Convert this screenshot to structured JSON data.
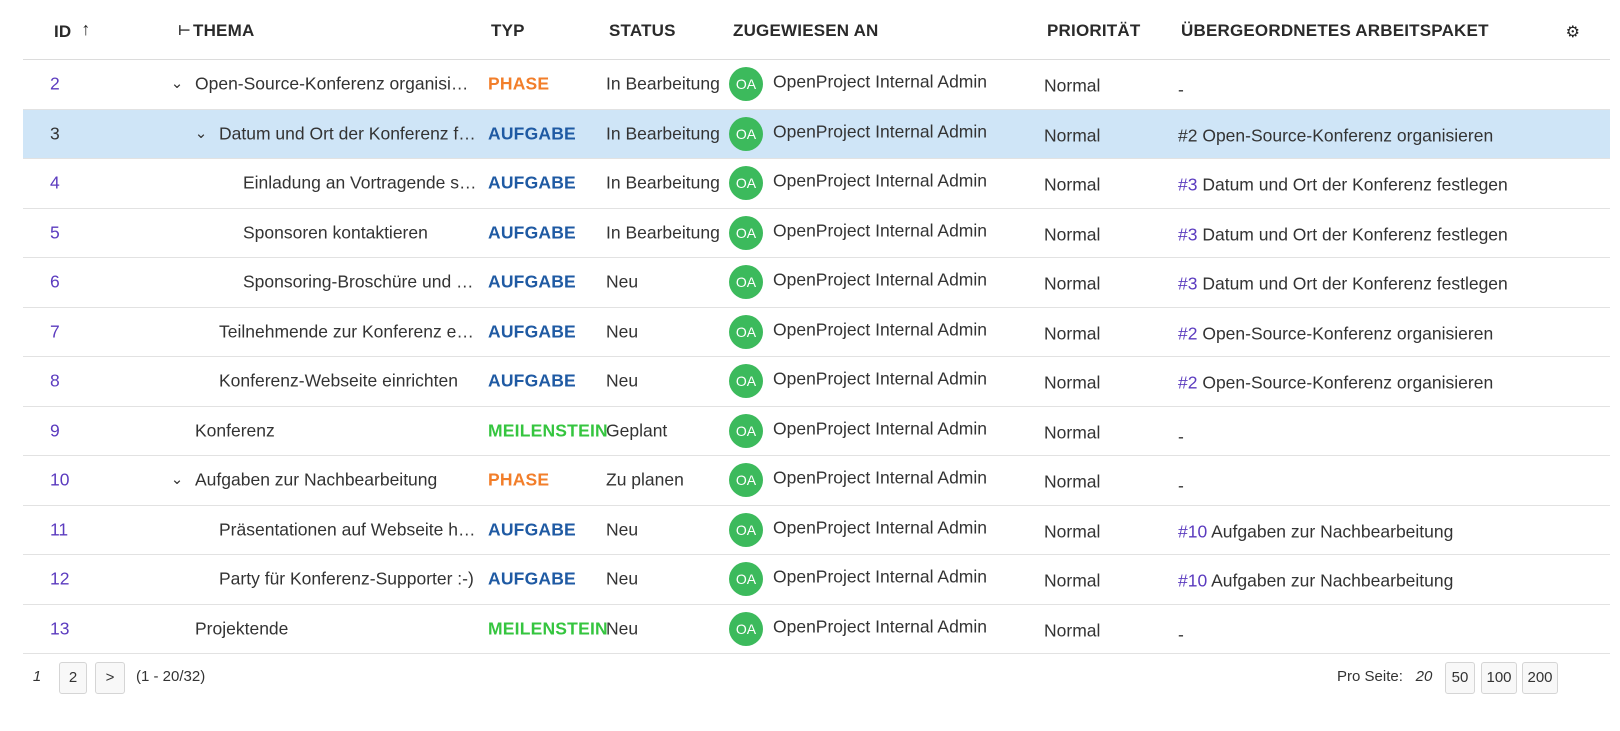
{
  "header": {
    "id": "ID",
    "sort_icon": "↑",
    "hierarchy_icon": "⊢",
    "subject": "THEMA",
    "type": "TYP",
    "status": "STATUS",
    "assignee": "ZUGEWIESEN AN",
    "priority": "PRIORITÄT",
    "parent": "ÜBERGEORDNETES ARBEITSPAKET",
    "settings_icon": "⚙"
  },
  "colors": {
    "phase": "#f27e2a",
    "task": "#1f5aa3",
    "milestone": "#35c53f",
    "link": "#5b3bbf",
    "selected_row": "#cfe5f7",
    "avatar": "#3cba5c"
  },
  "rows": [
    {
      "id": "2",
      "subject": "Open-Source-Konferenz organisiere...",
      "type": "PHASE",
      "type_color": "#f27e2a",
      "status": "In Bearbeitung",
      "avatar": "OA",
      "assignee": "OpenProject Internal Admin",
      "priority": "Normal",
      "parent_id": "",
      "parent_title": "-",
      "level": 0,
      "expandable": true,
      "selected": false
    },
    {
      "id": "3",
      "subject": "Datum und Ort der Konferenz fe...",
      "type": "AUFGABE",
      "type_color": "#1f5aa3",
      "status": "In Bearbeitung",
      "avatar": "OA",
      "assignee": "OpenProject Internal Admin",
      "priority": "Normal",
      "parent_id": "#2",
      "parent_title": " Open-Source-Konferenz organisieren",
      "level": 1,
      "expandable": true,
      "selected": true
    },
    {
      "id": "4",
      "subject": "Einladung an Vortragende se...",
      "type": "AUFGABE",
      "type_color": "#1f5aa3",
      "status": "In Bearbeitung",
      "avatar": "OA",
      "assignee": "OpenProject Internal Admin",
      "priority": "Normal",
      "parent_id": "#3",
      "parent_title": " Datum und Ort der Konferenz festlegen",
      "level": 2,
      "expandable": false,
      "selected": false
    },
    {
      "id": "5",
      "subject": "Sponsoren kontaktieren",
      "type": "AUFGABE",
      "type_color": "#1f5aa3",
      "status": "In Bearbeitung",
      "avatar": "OA",
      "assignee": "OpenProject Internal Admin",
      "priority": "Normal",
      "parent_id": "#3",
      "parent_title": " Datum und Ort der Konferenz festlegen",
      "level": 2,
      "expandable": false,
      "selected": false
    },
    {
      "id": "6",
      "subject": "Sponsoring-Broschüre und Fl...",
      "type": "AUFGABE",
      "type_color": "#1f5aa3",
      "status": "Neu",
      "avatar": "OA",
      "assignee": "OpenProject Internal Admin",
      "priority": "Normal",
      "parent_id": "#3",
      "parent_title": " Datum und Ort der Konferenz festlegen",
      "level": 2,
      "expandable": false,
      "selected": false
    },
    {
      "id": "7",
      "subject": "Teilnehmende zur Konferenz einl...",
      "type": "AUFGABE",
      "type_color": "#1f5aa3",
      "status": "Neu",
      "avatar": "OA",
      "assignee": "OpenProject Internal Admin",
      "priority": "Normal",
      "parent_id": "#2",
      "parent_title": " Open-Source-Konferenz organisieren",
      "level": 1,
      "expandable": false,
      "selected": false
    },
    {
      "id": "8",
      "subject": "Konferenz-Webseite einrichten",
      "type": "AUFGABE",
      "type_color": "#1f5aa3",
      "status": "Neu",
      "avatar": "OA",
      "assignee": "OpenProject Internal Admin",
      "priority": "Normal",
      "parent_id": "#2",
      "parent_title": " Open-Source-Konferenz organisieren",
      "level": 1,
      "expandable": false,
      "selected": false
    },
    {
      "id": "9",
      "subject": "Konferenz",
      "type": "MEILENSTEIN",
      "type_color": "#35c53f",
      "status": "Geplant",
      "avatar": "OA",
      "assignee": "OpenProject Internal Admin",
      "priority": "Normal",
      "parent_id": "",
      "parent_title": "-",
      "level": 0,
      "expandable": false,
      "selected": false
    },
    {
      "id": "10",
      "subject": "Aufgaben zur Nachbearbeitung",
      "type": "PHASE",
      "type_color": "#f27e2a",
      "status": "Zu planen",
      "avatar": "OA",
      "assignee": "OpenProject Internal Admin",
      "priority": "Normal",
      "parent_id": "",
      "parent_title": "-",
      "level": 0,
      "expandable": true,
      "selected": false
    },
    {
      "id": "11",
      "subject": "Präsentationen auf Webseite ho...",
      "type": "AUFGABE",
      "type_color": "#1f5aa3",
      "status": "Neu",
      "avatar": "OA",
      "assignee": "OpenProject Internal Admin",
      "priority": "Normal",
      "parent_id": "#10",
      "parent_title": " Aufgaben zur Nachbearbeitung",
      "level": 1,
      "expandable": false,
      "selected": false
    },
    {
      "id": "12",
      "subject": "Party für Konferenz-Supporter :-)",
      "type": "AUFGABE",
      "type_color": "#1f5aa3",
      "status": "Neu",
      "avatar": "OA",
      "assignee": "OpenProject Internal Admin",
      "priority": "Normal",
      "parent_id": "#10",
      "parent_title": " Aufgaben zur Nachbearbeitung",
      "level": 1,
      "expandable": false,
      "selected": false
    },
    {
      "id": "13",
      "subject": "Projektende",
      "type": "MEILENSTEIN",
      "type_color": "#35c53f",
      "status": "Neu",
      "avatar": "OA",
      "assignee": "OpenProject Internal Admin",
      "priority": "Normal",
      "parent_id": "",
      "parent_title": "-",
      "level": 0,
      "expandable": false,
      "selected": false
    }
  ],
  "pagination": {
    "current": "1",
    "pages": [
      "2"
    ],
    "next": ">",
    "range": "(1 - 20/32)",
    "per_page_label": "Pro Seite:",
    "per_page_current": "20",
    "per_page_options": [
      "50",
      "100",
      "200"
    ]
  }
}
